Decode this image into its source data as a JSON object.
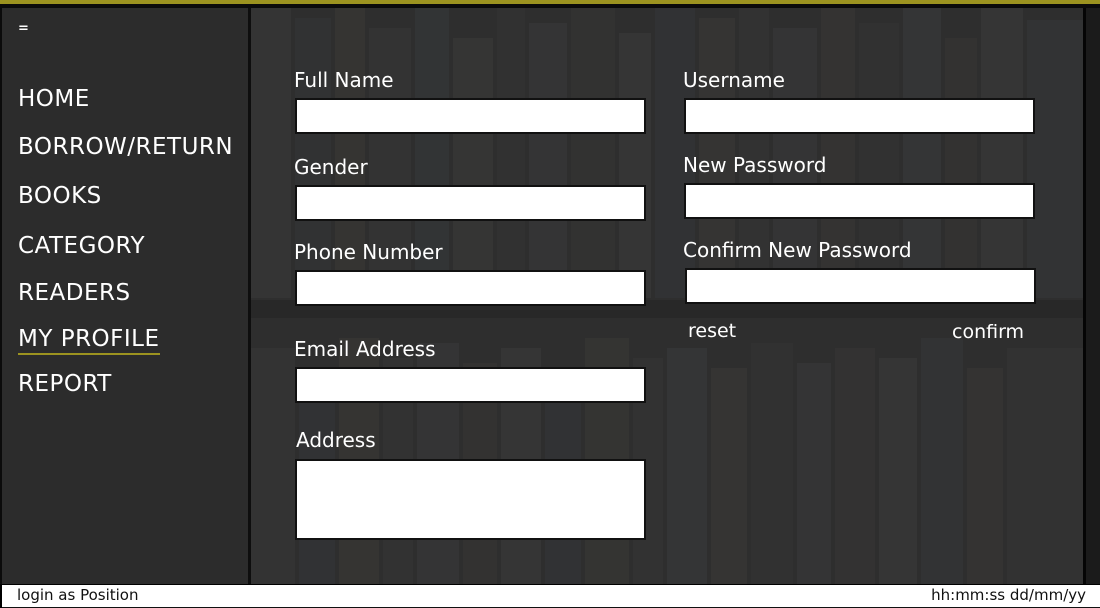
{
  "sidebar": {
    "toggle": "=",
    "items": [
      {
        "label": "HOME"
      },
      {
        "label": "BORROW/RETURN"
      },
      {
        "label": "BOOKS"
      },
      {
        "label": "CATEGORY"
      },
      {
        "label": "READERS"
      },
      {
        "label": "MY PROFILE",
        "active": true
      },
      {
        "label": "REPORT"
      }
    ]
  },
  "form": {
    "full_name": {
      "label": "Full Name",
      "value": ""
    },
    "gender": {
      "label": "Gender",
      "value": ""
    },
    "phone": {
      "label": "Phone Number",
      "value": ""
    },
    "email": {
      "label": "Email Address",
      "value": ""
    },
    "address": {
      "label": "Address",
      "value": ""
    },
    "username": {
      "label": "Username",
      "value": ""
    },
    "new_password": {
      "label": "New Password",
      "value": ""
    },
    "confirm_password": {
      "label": "Confirm New Password",
      "value": ""
    },
    "reset_label": "reset",
    "confirm_label": "confirm"
  },
  "status": {
    "login_text": "login as Position",
    "datetime": "hh:mm:ss dd/mm/yy"
  },
  "colors": {
    "accent": "#9c9320",
    "sidebar_bg": "#2c2c2c",
    "main_bg": "#2d2d2d"
  }
}
